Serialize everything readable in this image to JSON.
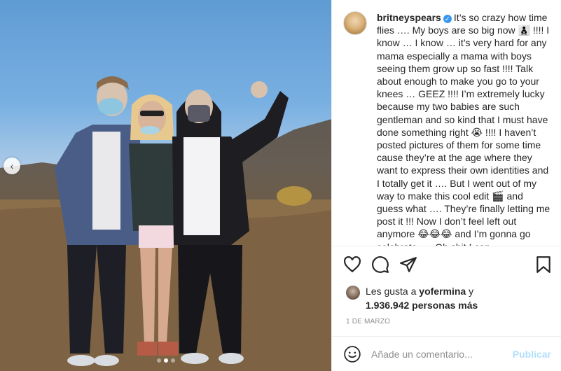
{
  "post": {
    "username": "britneyspears",
    "caption": "It’s so crazy how time flies …. My boys are so big now 👨‍👦‍👦 !!!! I know … I know … it’s very hard for any mama especially a mama with boys seeing them grow up so fast !!!! Talk about enough to make you go to your knees … GEEZ  !!!! I’m extremely lucky because my two babies are such gentleman and so kind that I must have done something right 😭 !!!! I haven’t posted pictures of them for some time cause they’re at the age where they want to express their own identities and I totally get it …. But I went out of my way to make this cool edit 🎬 and guess what …. They’re finally letting me post it !!! Now I don’t feel left out anymore 😂😂😂 and I’m gonna go celebrate …. Oh shit I can …",
    "likes_prefix": "Les gusta a",
    "likes_user": "yofermina",
    "likes_conjunction": "y",
    "likes_count": "1.936.942 personas más",
    "date": "1 DE MARZO",
    "comment_placeholder": "Añade un comentario...",
    "publish_label": "Publicar"
  },
  "carousel": {
    "prev_symbol": "‹",
    "total_slides": 3,
    "active_slide": 2
  },
  "icons": {
    "like": "heart-icon",
    "comment": "comment-icon",
    "share": "share-icon",
    "save": "bookmark-icon",
    "emoji": "smiley-icon",
    "verified": "verified-icon"
  },
  "colors": {
    "publish_disabled": "#b2dffc",
    "verified_blue": "#3897f0",
    "muted_text": "#8e8e8e"
  }
}
